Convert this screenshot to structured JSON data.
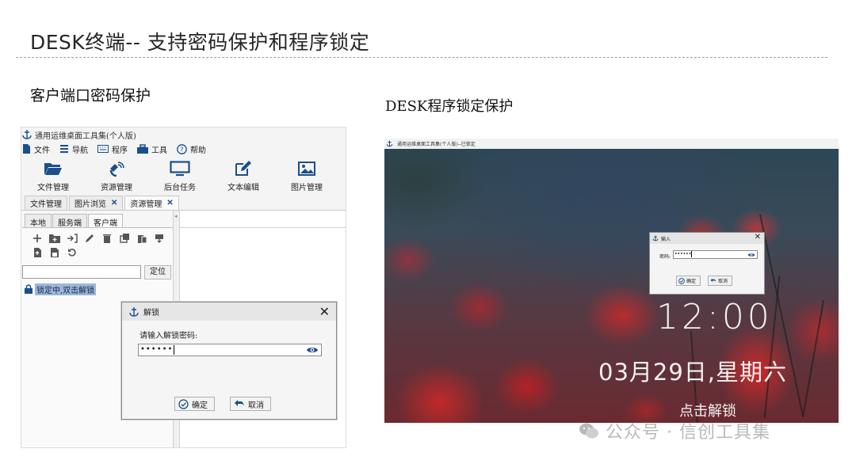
{
  "slide": {
    "title": "DESK终端--  支持密码保护和程序锁定",
    "left_heading": "客户端口密码保护",
    "right_heading": "DESK程序锁定保护"
  },
  "app": {
    "window_title": "通用运维桌面工具集(个人版)",
    "menu": [
      {
        "label": "文件",
        "icon": "file-icon"
      },
      {
        "label": "导航",
        "icon": "menu-lines-icon"
      },
      {
        "label": "程序",
        "icon": "keyboard-icon"
      },
      {
        "label": "工具",
        "icon": "toolbox-icon"
      },
      {
        "label": "帮助",
        "icon": "help-circle-icon"
      }
    ],
    "toolbar": [
      {
        "label": "文件管理",
        "icon": "folder-open-icon"
      },
      {
        "label": "资源管理",
        "icon": "satellite-icon"
      },
      {
        "label": "后台任务",
        "icon": "monitor-icon"
      },
      {
        "label": "文本编辑",
        "icon": "edit-icon"
      },
      {
        "label": "图片管理",
        "icon": "image-icon"
      }
    ],
    "doc_tabs": [
      {
        "label": "文件管理",
        "closable": false
      },
      {
        "label": "图片浏览",
        "closable": true
      },
      {
        "label": "资源管理",
        "closable": true
      }
    ],
    "sub_tabs": [
      "本地",
      "服务端",
      "客户端"
    ],
    "locate_label": "定位",
    "path_value": "",
    "tree_item": "锁定中,双击解锁",
    "accent_color": "#1a4f8a",
    "selection_color": "#9bb6dc"
  },
  "unlock_dialog": {
    "title": "解锁",
    "close": "✕",
    "prompt": "请输入解锁密码:",
    "password": "••••••",
    "ok_label": "确定",
    "cancel_label": "取消"
  },
  "lock_screen": {
    "window_title": "通用运维桌面工具集(个人版)--已锁定",
    "dialog": {
      "title": "输入",
      "close": "✕",
      "field_label": "密码:",
      "password": "••••••",
      "ok_label": "确定",
      "cancel_label": "取消"
    },
    "time": "12:00",
    "date": "03月29日,星期六",
    "hint": "点击解锁"
  },
  "watermark": "公众号 · 信创工具集"
}
